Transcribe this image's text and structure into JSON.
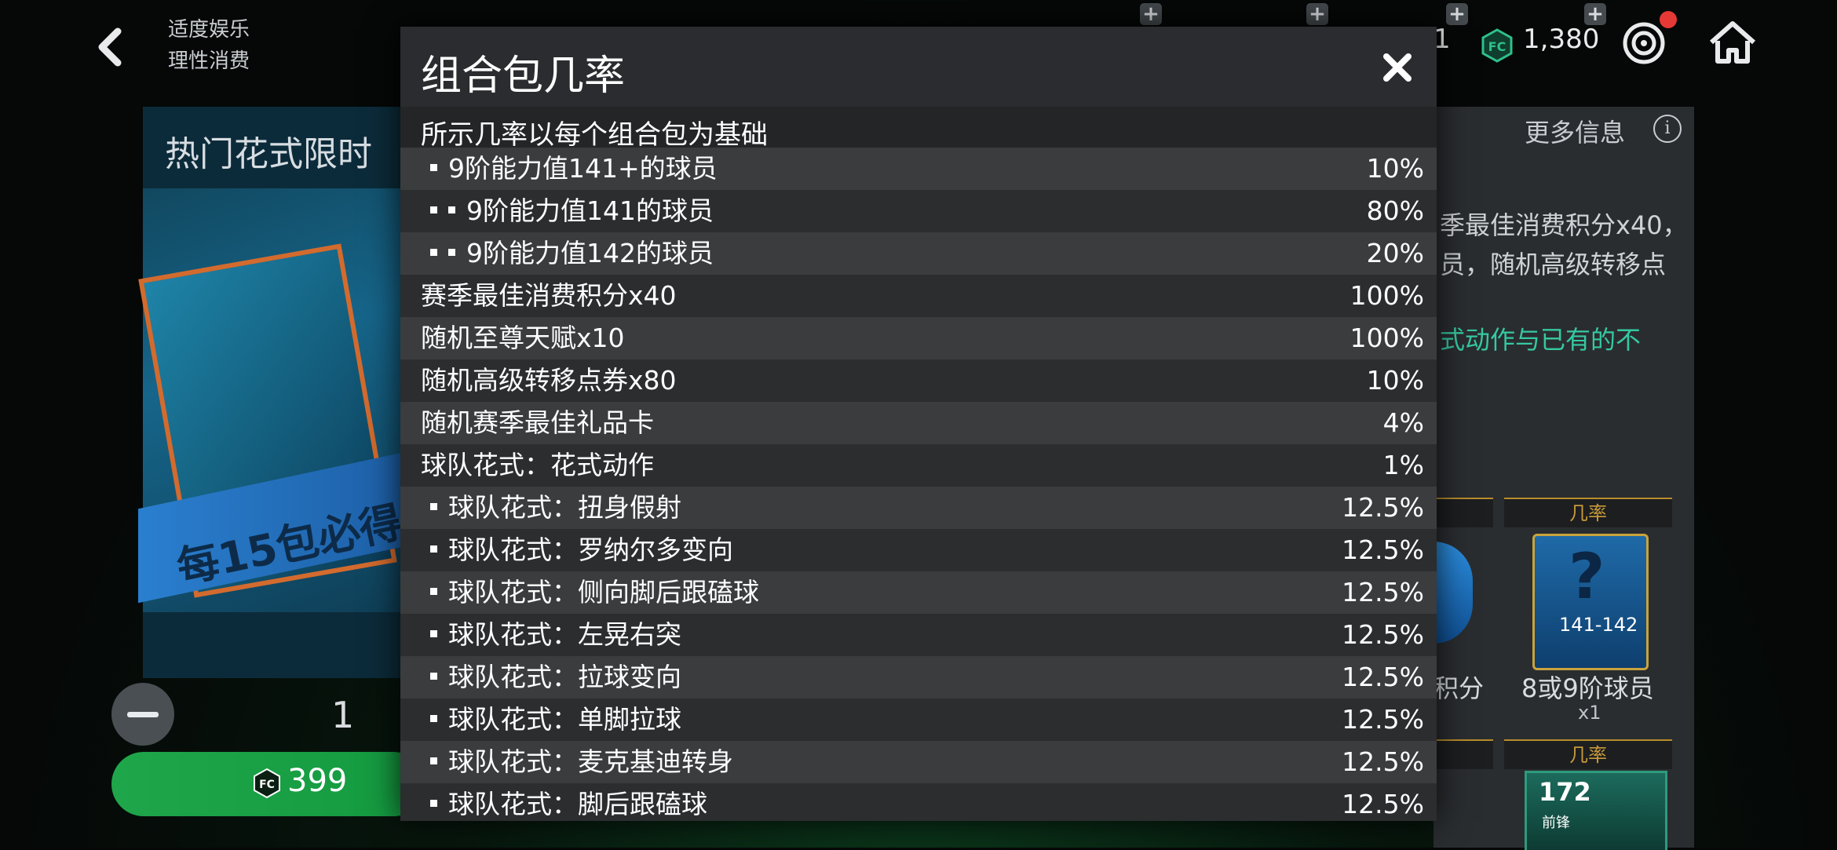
{
  "topbar": {
    "notice_line1": "适度娱乐",
    "notice_line2": "理性消费",
    "fragment_value": "1",
    "currency_value": "1,380"
  },
  "left_pack": {
    "title": "热门花式限时",
    "banner": "每15包必得",
    "quantity": "1",
    "price": "399"
  },
  "right_panel": {
    "more_info": "更多信息",
    "info_icon": "i",
    "text_line1": "季最佳消费积分x40，",
    "text_line2": "员，随机高级转移点",
    "text_line3": "式动作与已有的不",
    "card1_header": "几率",
    "card1_rating": "141-142",
    "card1_label": "8或9阶球员",
    "card1_count": "x1",
    "card0_label": "积分",
    "card2_header": "几率",
    "card2_rating": "172",
    "card2_pos": "前锋"
  },
  "modal": {
    "title": "组合包几率",
    "subtitle": "所示几率以每个组合包为基础",
    "rows": [
      {
        "label": "9阶能力值141+的球员",
        "value": "10%",
        "level": 1
      },
      {
        "label": "9阶能力值141的球员",
        "value": "80%",
        "level": 2
      },
      {
        "label": "9阶能力值142的球员",
        "value": "20%",
        "level": 2
      },
      {
        "label": "赛季最佳消费积分x40",
        "value": "100%",
        "level": 0
      },
      {
        "label": "随机至尊天赋x10",
        "value": "100%",
        "level": 0
      },
      {
        "label": "随机高级转移点券x80",
        "value": "10%",
        "level": 0
      },
      {
        "label": "随机赛季最佳礼品卡",
        "value": "4%",
        "level": 0
      },
      {
        "label": "球队花式：花式动作",
        "value": "1%",
        "level": 0
      },
      {
        "label": "球队花式：扭身假射",
        "value": "12.5%",
        "level": 1
      },
      {
        "label": "球队花式：罗纳尔多变向",
        "value": "12.5%",
        "level": 1
      },
      {
        "label": "球队花式：侧向脚后跟磕球",
        "value": "12.5%",
        "level": 1
      },
      {
        "label": "球队花式：左晃右突",
        "value": "12.5%",
        "level": 1
      },
      {
        "label": "球队花式：拉球变向",
        "value": "12.5%",
        "level": 1
      },
      {
        "label": "球队花式：单脚拉球",
        "value": "12.5%",
        "level": 1
      },
      {
        "label": "球队花式：麦克基迪转身",
        "value": "12.5%",
        "level": 1
      },
      {
        "label": "球队花式：脚后跟磕球",
        "value": "12.5%",
        "level": 1
      }
    ]
  }
}
